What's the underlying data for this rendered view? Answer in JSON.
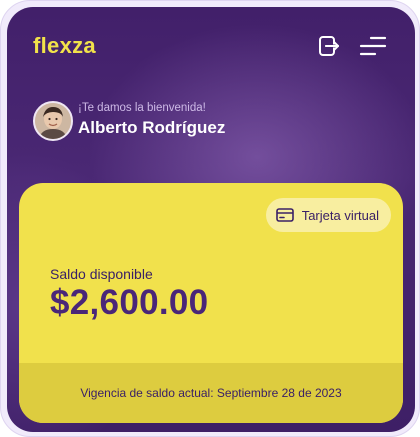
{
  "brand": {
    "logo_text": "flexza",
    "accent": "#f2e24a",
    "background": "#42206a"
  },
  "header": {
    "exit_icon": "logout-icon",
    "menu_icon": "menu-icon"
  },
  "user": {
    "greeting": "¡Te damos la bienvenida!",
    "name": "Alberto Rodríguez"
  },
  "balance_card": {
    "virtual_card_label": "Tarjeta virtual",
    "virtual_card_icon": "credit-card-icon",
    "balance_label": "Saldo disponible",
    "balance_amount": "$2,600.00",
    "validity_text": "Vigencia de saldo actual: Septiembre 28 de 2023",
    "card_color": "#f1e14c"
  }
}
